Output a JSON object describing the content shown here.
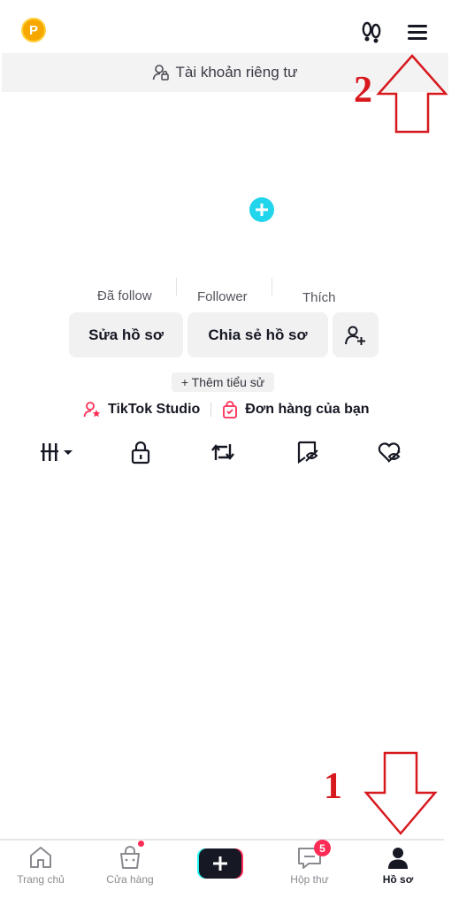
{
  "top": {
    "coin_letter": "P",
    "private_account": "Tài khoản riêng tư"
  },
  "annotations": {
    "label_2": "2",
    "label_1": "1",
    "color": "#d7191e"
  },
  "stats": {
    "following": "Đã follow",
    "followers": "Follower",
    "likes": "Thích"
  },
  "buttons": {
    "edit_profile": "Sửa hồ sơ",
    "share_profile": "Chia sẻ hồ sơ"
  },
  "bio_button": "+ Thêm tiểu sử",
  "links": {
    "studio": "TikTok Studio",
    "orders": "Đơn hàng của bạn"
  },
  "tabs": [
    "videos-grid-icon",
    "lock-icon",
    "repost-icon",
    "favorites-icon",
    "liked-icon"
  ],
  "bottom_nav": {
    "home": "Trang chủ",
    "shop": "Cửa hàng",
    "inbox": "Hộp thư",
    "inbox_badge": "5",
    "profile": "Hồ sơ"
  },
  "colors": {
    "accent_red": "#fe2c55",
    "accent_cyan": "#20d5ec"
  }
}
